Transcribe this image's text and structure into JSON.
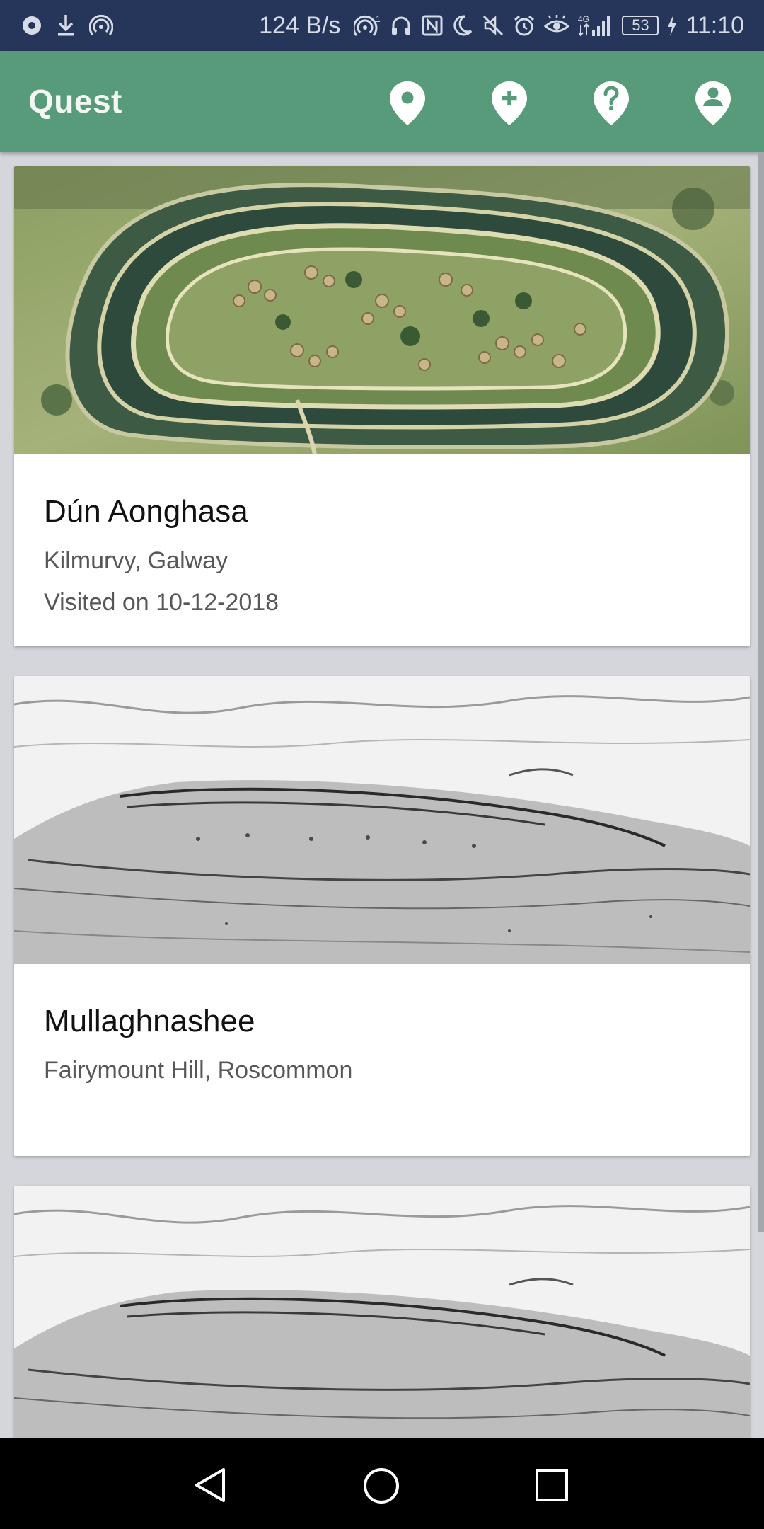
{
  "status_bar": {
    "net_speed": "124 B/s",
    "network": "4G",
    "battery": "53",
    "time": "11:10"
  },
  "app_bar": {
    "title": "Quest",
    "actions": [
      "map-pin-icon",
      "add-location-icon",
      "help-icon",
      "account-icon"
    ]
  },
  "cards": [
    {
      "title": "Dún Aonghasa",
      "location": "Kilmurvy, Galway",
      "visited": "Visited on 10-12-2018",
      "image_style": "color aerial illustration"
    },
    {
      "title": "Mullaghnashee",
      "location": "Fairymount Hill, Roscommon",
      "image_style": "pencil sketch"
    },
    {
      "image_style": "pencil sketch"
    }
  ],
  "nav_bar": [
    "back-icon",
    "home-icon",
    "recents-icon"
  ]
}
